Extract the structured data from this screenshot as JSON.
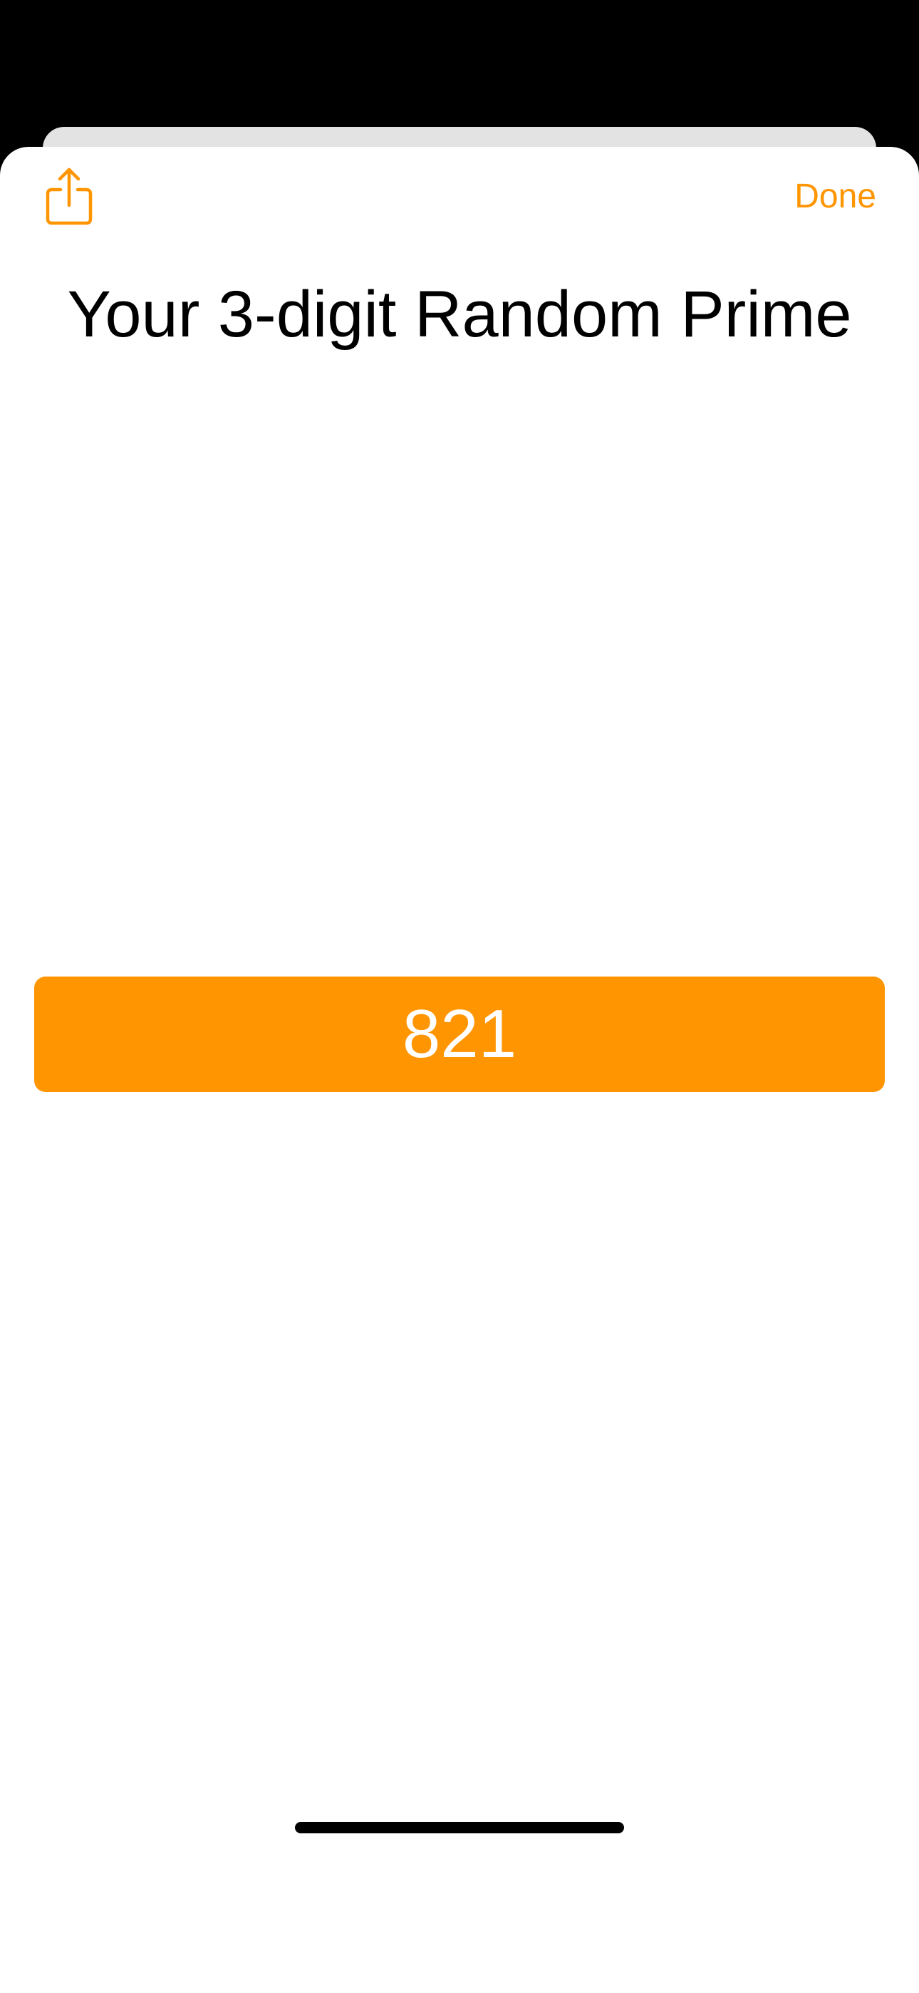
{
  "colors": {
    "accent": "#ff9500",
    "background": "#000000",
    "sheet": "#ffffff",
    "back_sheet": "#e3e3e3",
    "title_text": "#000000",
    "result_text": "#ffffff"
  },
  "toolbar": {
    "share_icon": "share-icon",
    "done_label": "Done"
  },
  "main": {
    "title": "Your 3-digit Random Prime",
    "result": "821"
  }
}
